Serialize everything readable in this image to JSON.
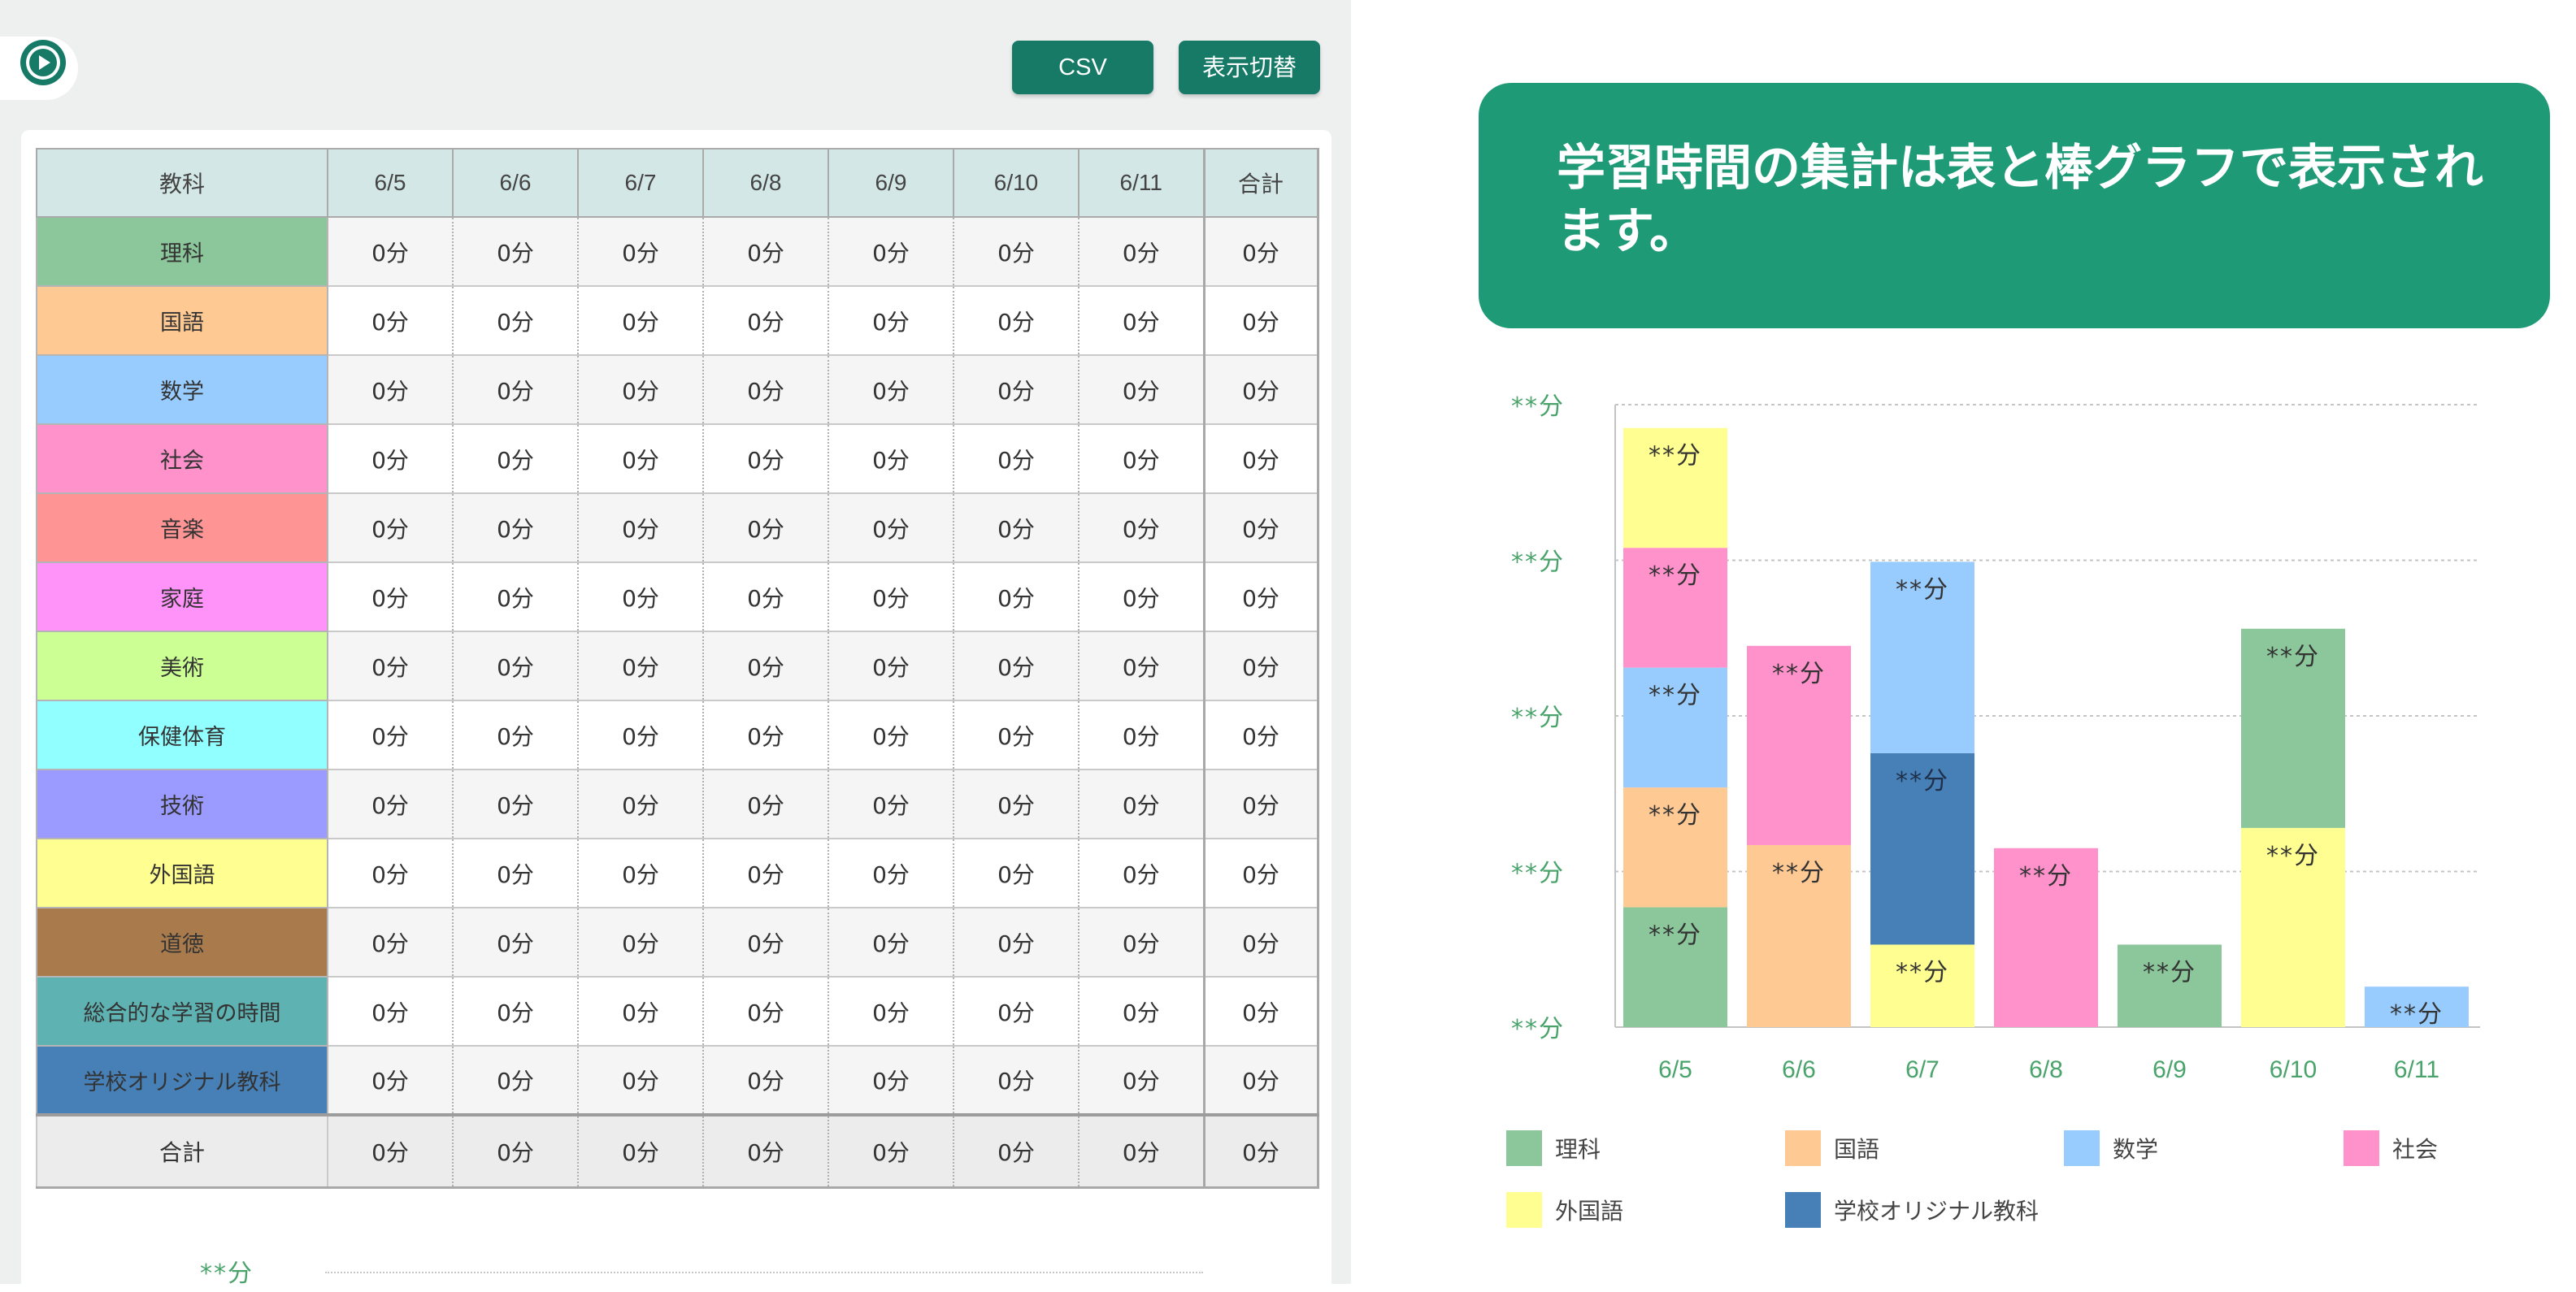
{
  "toolbar": {
    "csv_label": "CSV",
    "toggle_label": "表示切替"
  },
  "table": {
    "header": [
      "教科",
      "6/5",
      "6/6",
      "6/7",
      "6/8",
      "6/9",
      "6/10",
      "6/11",
      "合計"
    ],
    "rows": [
      {
        "subject": "理科",
        "color": "#8bc79a",
        "values": [
          "0分",
          "0分",
          "0分",
          "0分",
          "0分",
          "0分",
          "0分"
        ],
        "total": "0分"
      },
      {
        "subject": "国語",
        "color": "#ffc994",
        "values": [
          "0分",
          "0分",
          "0分",
          "0分",
          "0分",
          "0分",
          "0分"
        ],
        "total": "0分"
      },
      {
        "subject": "数学",
        "color": "#98ccff",
        "values": [
          "0分",
          "0分",
          "0分",
          "0分",
          "0分",
          "0分",
          "0分"
        ],
        "total": "0分"
      },
      {
        "subject": "社会",
        "color": "#ff91cb",
        "values": [
          "0分",
          "0分",
          "0分",
          "0分",
          "0分",
          "0分",
          "0分"
        ],
        "total": "0分"
      },
      {
        "subject": "音楽",
        "color": "#ff9494",
        "values": [
          "0分",
          "0分",
          "0分",
          "0分",
          "0分",
          "0分",
          "0分"
        ],
        "total": "0分"
      },
      {
        "subject": "家庭",
        "color": "#ff93fa",
        "values": [
          "0分",
          "0分",
          "0分",
          "0分",
          "0分",
          "0分",
          "0分"
        ],
        "total": "0分"
      },
      {
        "subject": "美術",
        "color": "#ccff94",
        "values": [
          "0分",
          "0分",
          "0分",
          "0分",
          "0分",
          "0分",
          "0分"
        ],
        "total": "0分"
      },
      {
        "subject": "保健体育",
        "color": "#91ffff",
        "values": [
          "0分",
          "0分",
          "0分",
          "0分",
          "0分",
          "0分",
          "0分"
        ],
        "total": "0分"
      },
      {
        "subject": "技術",
        "color": "#9a9aff",
        "values": [
          "0分",
          "0分",
          "0分",
          "0分",
          "0分",
          "0分",
          "0分"
        ],
        "total": "0分"
      },
      {
        "subject": "外国語",
        "color": "#ffff91",
        "values": [
          "0分",
          "0分",
          "0分",
          "0分",
          "0分",
          "0分",
          "0分"
        ],
        "total": "0分"
      },
      {
        "subject": "道徳",
        "color": "#a87a4c",
        "values": [
          "0分",
          "0分",
          "0分",
          "0分",
          "0分",
          "0分",
          "0分"
        ],
        "total": "0分"
      },
      {
        "subject": "総合的な学習の時間",
        "color": "#5eb2b2",
        "values": [
          "0分",
          "0分",
          "0分",
          "0分",
          "0分",
          "0分",
          "0分"
        ],
        "total": "0分"
      },
      {
        "subject": "学校オリジナル教科",
        "color": "#4680b6",
        "values": [
          "0分",
          "0分",
          "0分",
          "0分",
          "0分",
          "0分",
          "0分"
        ],
        "total": "0分"
      }
    ],
    "footer": {
      "label": "合計",
      "values": [
        "0分",
        "0分",
        "0分",
        "0分",
        "0分",
        "0分",
        "0分"
      ],
      "total": "0分"
    }
  },
  "left_partial_label": "**分",
  "callout": {
    "text": "学習時間の集計は表と棒グラフで表示されます。"
  },
  "chart_data": {
    "type": "bar",
    "stacked": true,
    "categories": [
      "6/5",
      "6/6",
      "6/7",
      "6/8",
      "6/9",
      "6/10",
      "6/11"
    ],
    "y_tick_labels": [
      "**分",
      "**分",
      "**分",
      "**分",
      "**分"
    ],
    "segment_label": "**分",
    "ylim": [
      0,
      4
    ],
    "grid": true,
    "legend_position": "bottom",
    "series": [
      {
        "name": "理科",
        "color": "#8bc79a",
        "values": [
          0.77,
          0,
          0,
          0,
          0.53,
          1.28,
          0
        ]
      },
      {
        "name": "国語",
        "color": "#ffc994",
        "values": [
          0.77,
          1.17,
          0,
          0,
          0,
          0,
          0
        ]
      },
      {
        "name": "数学",
        "color": "#98ccff",
        "values": [
          0.77,
          0,
          1.23,
          0,
          0,
          0,
          0.26
        ]
      },
      {
        "name": "社会",
        "color": "#ff91cb",
        "values": [
          0.77,
          1.28,
          0,
          1.15,
          0,
          0,
          0
        ]
      },
      {
        "name": "外国語",
        "color": "#ffff91",
        "values": [
          0.77,
          0,
          0.53,
          0,
          0,
          1.28,
          0
        ]
      },
      {
        "name": "学校オリジナル教科",
        "color": "#4680b6",
        "values": [
          0,
          0,
          1.23,
          0,
          0,
          0,
          0
        ]
      }
    ],
    "segment_values": [
      [
        0.77,
        0.77,
        0.77,
        0.77,
        0.77
      ],
      [
        1.17,
        1.28
      ],
      [
        0.53,
        1.23,
        1.23
      ],
      [
        1.15
      ],
      [
        0.53
      ],
      [
        1.28,
        1.28
      ],
      [
        0.26
      ]
    ],
    "segment_series": [
      [
        "理科",
        "国語",
        "数学",
        "社会",
        "外国語"
      ],
      [
        "国語",
        "社会"
      ],
      [
        "外国語",
        "学校オリジナル教科",
        "数学"
      ],
      [
        "社会"
      ],
      [
        "理科"
      ],
      [
        "外国語",
        "理科"
      ],
      [
        "数学"
      ]
    ]
  },
  "legend": [
    {
      "name": "理科",
      "color": "#8bc79a"
    },
    {
      "name": "国語",
      "color": "#ffc994"
    },
    {
      "name": "数学",
      "color": "#98ccff"
    },
    {
      "name": "社会",
      "color": "#ff91cb"
    },
    {
      "name": "外国語",
      "color": "#ffff91"
    },
    {
      "name": "学校オリジナル教科",
      "color": "#4680b6"
    }
  ]
}
